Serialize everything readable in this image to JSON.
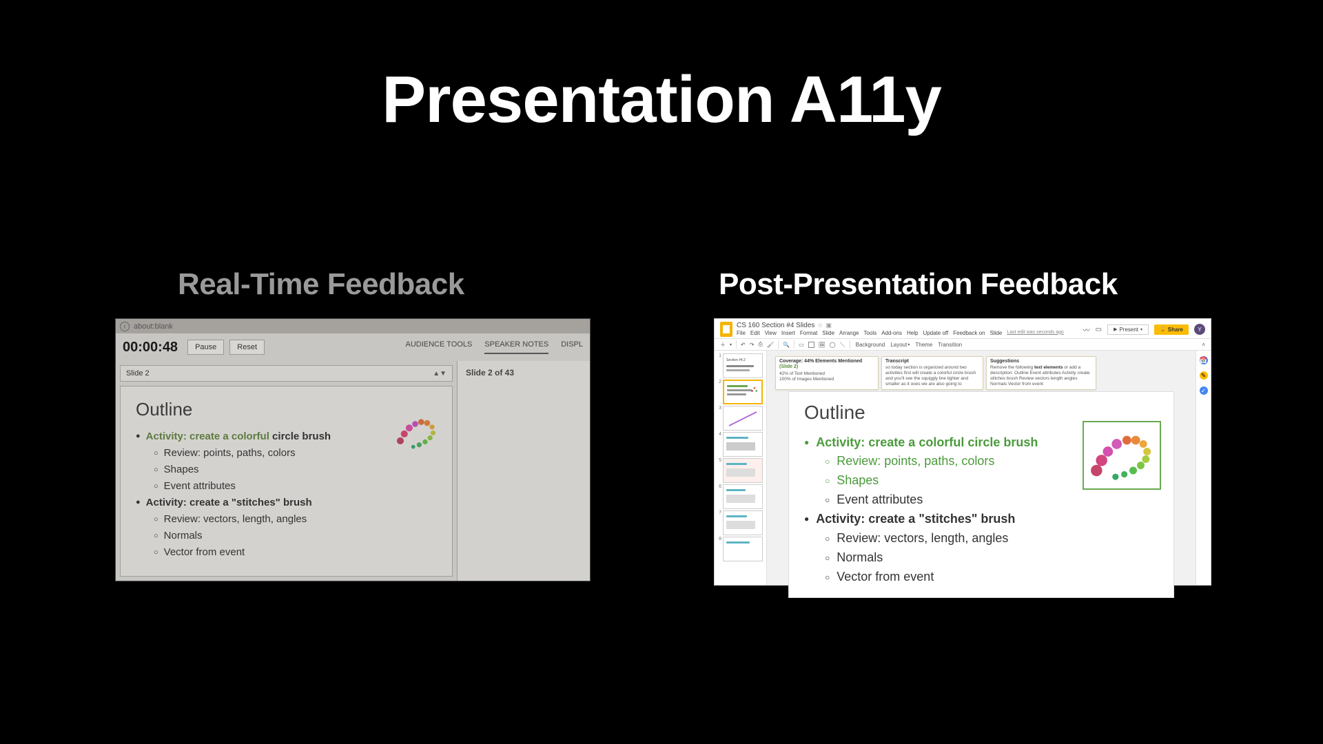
{
  "title": "Presentation A11y",
  "panels": {
    "left": {
      "title": "Real-Time Feedback"
    },
    "right": {
      "title": "Post-Presentation Feedback"
    }
  },
  "presenter": {
    "address": "about:blank",
    "timer": "00:00:48",
    "buttons": {
      "pause": "Pause",
      "reset": "Reset"
    },
    "tabs": {
      "audience": "AUDIENCE TOOLS",
      "notes": "SPEAKER NOTES",
      "display": "DISPL"
    },
    "slide_selector": "Slide 2",
    "notes_header": "Slide 2 of 43",
    "slide": {
      "heading": "Outline",
      "items": [
        {
          "prefix": "Activity: create a colorful",
          "suffix": " circle brush"
        },
        "Review: points, paths, colors",
        "Shapes",
        "Event attributes",
        "Activity: create a \"stitches\" brush",
        "Review: vectors, length, angles",
        "Normals",
        "Vector from event"
      ]
    }
  },
  "gslides": {
    "doc_title": "CS 160 Section #4 Slides",
    "menu": [
      "File",
      "Edit",
      "View",
      "Insert",
      "Format",
      "Slide",
      "Arrange",
      "Tools",
      "Add-ons",
      "Help",
      "Update off",
      "Feedback on",
      "Slide"
    ],
    "last_edit": "Last edit was seconds ago",
    "present": "Present",
    "share": "Share",
    "avatar": "Y",
    "toolbar": {
      "background": "Background",
      "layout": "Layout",
      "theme": "Theme",
      "transition": "Transition"
    },
    "callouts": {
      "coverage": {
        "hdr": "Coverage: 44% Elements Mentioned",
        "slide": "(Slide 2)",
        "l1": "42% of Text Mentioned",
        "l2": "100% of Images Mentioned"
      },
      "transcript": {
        "hdr": "Transcript",
        "body": "so today section is organized around two activities first will create a colorful circle brush and you'll see the squiggly line lighter and smaller as it ooes we are also going to"
      },
      "suggestions": {
        "hdr": "Suggestions",
        "body_pre": "Remove the following ",
        "bold": "text elements",
        "body_post": " or add a description: Outline Event attributes Activity create stitches brush Review vectors length angles Normals Vector from event"
      }
    },
    "slide": {
      "heading": "Outline",
      "b1": "Activity: create a colorful circle brush",
      "s1": "Review: points, paths, colors",
      "s2": "Shapes",
      "s3": "Event attributes",
      "b2": "Activity: create a \"stitches\" brush",
      "s4": "Review: vectors, length, angles",
      "s5": "Normals",
      "s6": "Vector from event"
    },
    "thumbs": [
      "1",
      "2",
      "3",
      "4",
      "5",
      "6",
      "7",
      "8"
    ]
  }
}
